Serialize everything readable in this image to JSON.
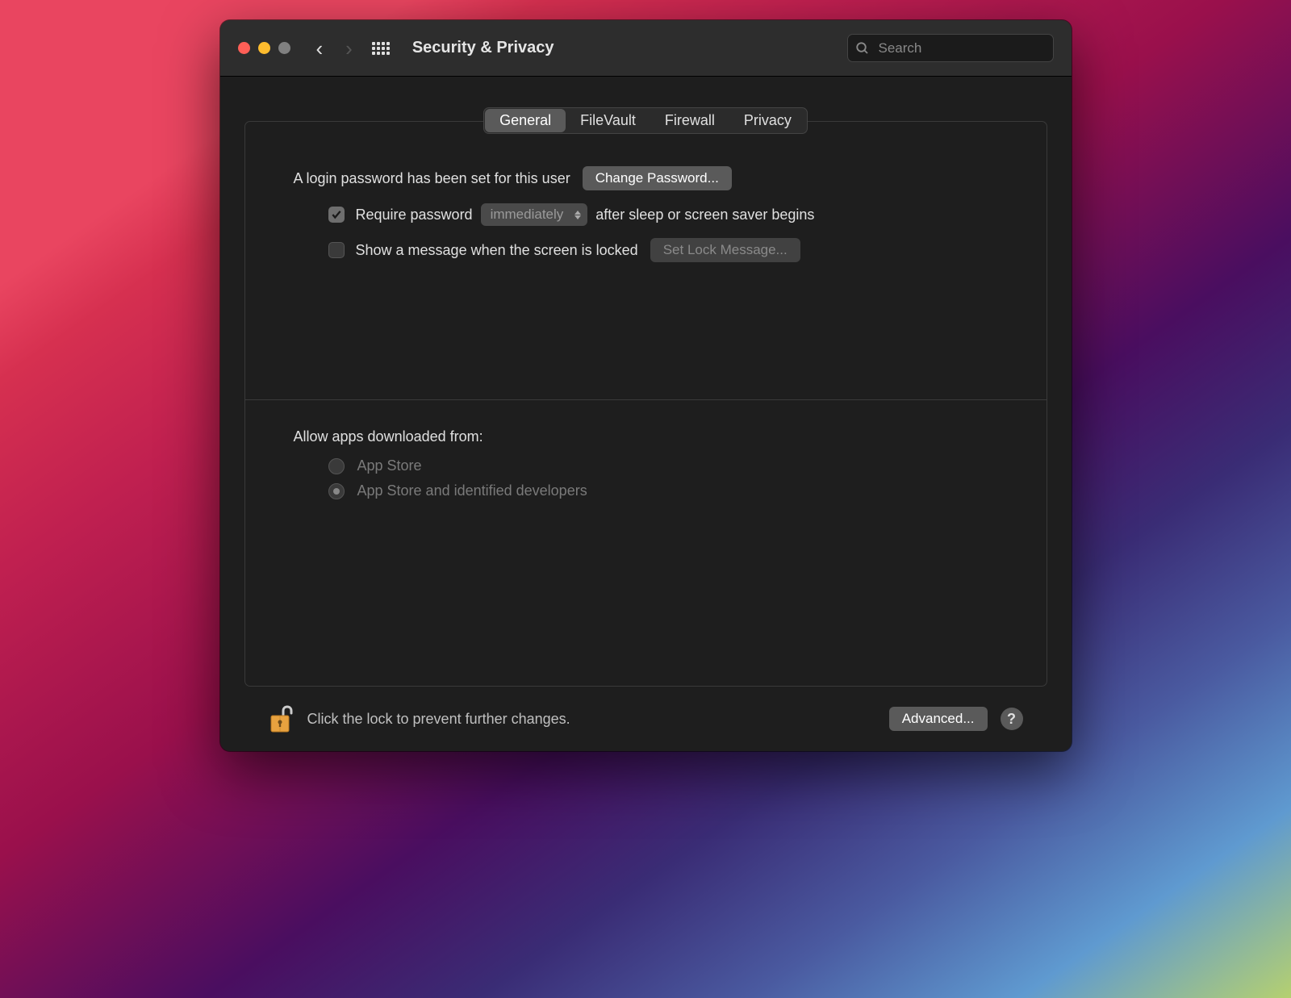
{
  "window": {
    "title": "Security & Privacy"
  },
  "search": {
    "placeholder": "Search"
  },
  "tabs": [
    {
      "label": "General",
      "active": true
    },
    {
      "label": "FileVault",
      "active": false
    },
    {
      "label": "Firewall",
      "active": false
    },
    {
      "label": "Privacy",
      "active": false
    }
  ],
  "general": {
    "password_set_label": "A login password has been set for this user",
    "change_password_button": "Change Password...",
    "require_password_label_before": "Require password",
    "require_password_select": "immediately",
    "require_password_label_after": "after sleep or screen saver begins",
    "show_message_label": "Show a message when the screen is locked",
    "set_lock_message_button": "Set Lock Message...",
    "allow_apps_label": "Allow apps downloaded from:",
    "radio_options": [
      {
        "label": "App Store",
        "selected": false
      },
      {
        "label": "App Store and identified developers",
        "selected": true
      }
    ]
  },
  "footer": {
    "lock_text": "Click the lock to prevent further changes.",
    "advanced_button": "Advanced...",
    "help": "?"
  }
}
